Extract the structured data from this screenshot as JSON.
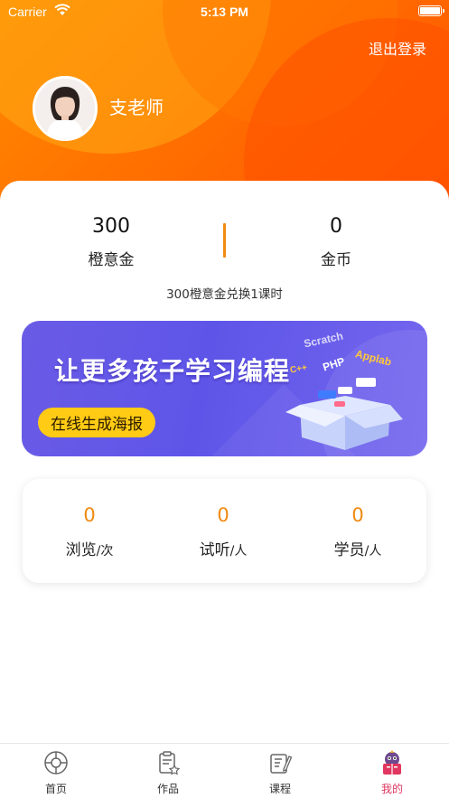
{
  "status_bar": {
    "carrier": "Carrier",
    "time": "5:13 PM"
  },
  "header": {
    "logout_label": "退出登录",
    "user_name": "支老师"
  },
  "wallet": {
    "orange_coin_value": "300",
    "orange_coin_label": "橙意金",
    "gold_value": "0",
    "gold_label": "金币",
    "exchange_note": "300橙意金兑换1课时"
  },
  "banner": {
    "title": "让更多孩子学习编程",
    "button_label": "在线生成海报",
    "tags": [
      "Scratch",
      "Applab",
      "PHP",
      "C++"
    ]
  },
  "counters": [
    {
      "value": "0",
      "label": "浏览",
      "unit": "/次"
    },
    {
      "value": "0",
      "label": "试听",
      "unit": "/人"
    },
    {
      "value": "0",
      "label": "学员",
      "unit": "/人"
    }
  ],
  "tabbar": {
    "tabs": [
      {
        "label": "首页",
        "icon": "home-icon"
      },
      {
        "label": "作品",
        "icon": "works-icon"
      },
      {
        "label": "课程",
        "icon": "course-icon"
      },
      {
        "label": "我的",
        "icon": "profile-icon",
        "active": true
      }
    ]
  },
  "colors": {
    "accent": "#f08a10",
    "header": "#ff6a00",
    "banner": "#6a5be6",
    "button": "#ffcb14",
    "active_tab": "#e0365f"
  }
}
